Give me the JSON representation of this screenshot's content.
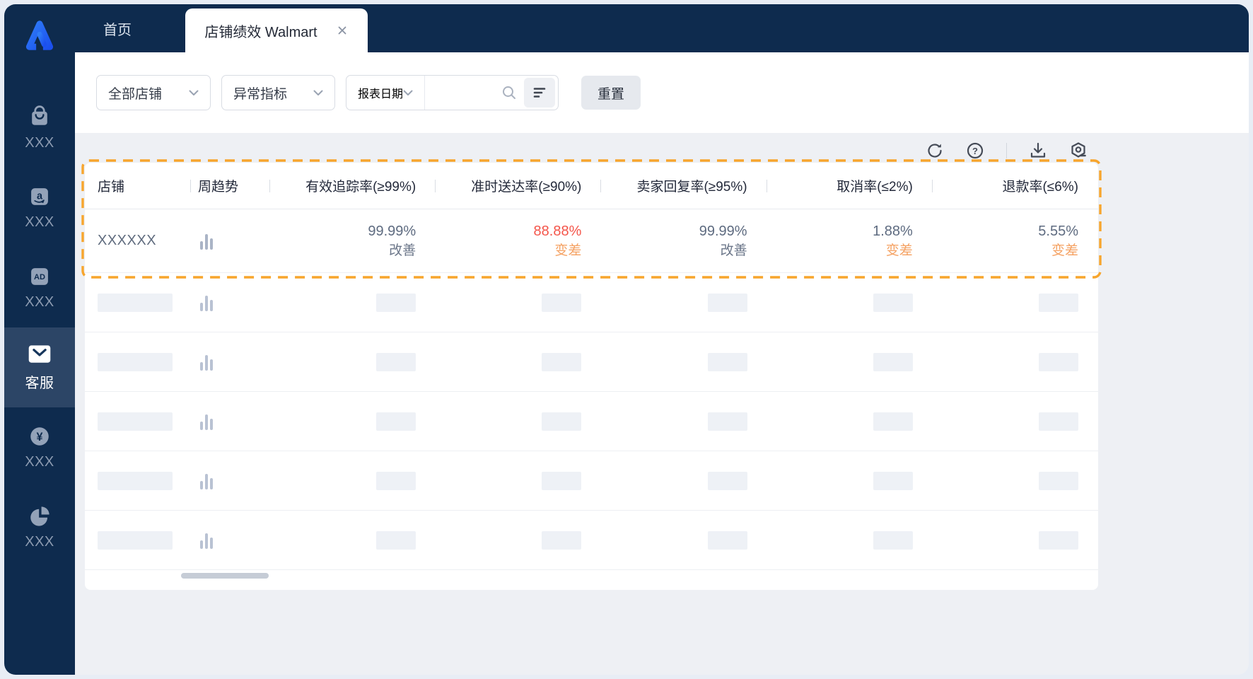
{
  "app": {
    "logo": "app-logo"
  },
  "sidebar": {
    "items": [
      {
        "id": "store",
        "icon": "shopping-bag-icon",
        "label": "XXX",
        "active": false
      },
      {
        "id": "amazon",
        "icon": "amazon-icon",
        "label": "XXX",
        "active": false
      },
      {
        "id": "ads",
        "icon": "ad-icon",
        "label": "XXX",
        "active": false
      },
      {
        "id": "customer-service",
        "icon": "envelope-icon",
        "label": "客服",
        "active": true
      },
      {
        "id": "finance",
        "icon": "yen-icon",
        "label": "XXX",
        "active": false
      },
      {
        "id": "reports",
        "icon": "pie-chart-icon",
        "label": "XXX",
        "active": false
      }
    ]
  },
  "tabs": {
    "home": "首页",
    "active_tab": "店铺绩效 Walmart"
  },
  "filters": {
    "store_dropdown": "全部店铺",
    "metric_dropdown": "异常指标",
    "date_dropdown": "报表日期",
    "search_placeholder": "",
    "reset_button": "重置"
  },
  "toolbar": {
    "icons": [
      "refresh",
      "help",
      "download",
      "settings"
    ]
  },
  "table": {
    "columns": [
      "店铺",
      "周趋势",
      "有效追踪率(≥99%)",
      "准时送达率(≥90%)",
      "卖家回复率(≥95%)",
      "取消率(≤2%)",
      "退款率(≤6%)"
    ],
    "row": {
      "store": "XXXXXX",
      "metrics": [
        {
          "value": "99.99%",
          "status": "改善",
          "tone": "normal"
        },
        {
          "value": "88.88%",
          "status": "变差",
          "tone": "alert"
        },
        {
          "value": "99.99%",
          "status": "改善",
          "tone": "normal"
        },
        {
          "value": "1.88%",
          "status": "变差",
          "tone": "warn"
        },
        {
          "value": "5.55%",
          "status": "变差",
          "tone": "warn"
        }
      ]
    },
    "skeleton_row_count": 6
  },
  "colors": {
    "navy": "#0E2B4E",
    "sidebar_active_bg": "#2C4566",
    "accent_blue": "#2B74F6",
    "highlight_dashed": "#F7A52D",
    "value_red": "#F4554A",
    "status_orange": "#F5A263",
    "value_gray": "#5E6B80",
    "content_bg": "#EEF0F4"
  }
}
